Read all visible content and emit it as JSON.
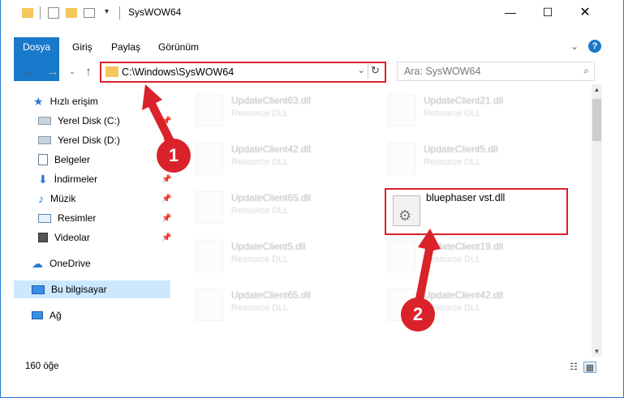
{
  "window": {
    "title": "SysWOW64",
    "controls": {
      "minimize_icon": "minimize-icon",
      "maximize_icon": "maximize-icon",
      "close_icon": "close-icon"
    }
  },
  "ribbon": {
    "tabs": [
      {
        "label": "Dosya"
      },
      {
        "label": "Giriş"
      },
      {
        "label": "Paylaş"
      },
      {
        "label": "Görünüm"
      }
    ]
  },
  "navigation": {
    "address_path": "C:\\Windows\\SysWOW64",
    "search_placeholder": "Ara: SysWOW64"
  },
  "sidebar": {
    "items": [
      {
        "label": "Hızlı erişim",
        "icon": "star-icon"
      },
      {
        "label": "Yerel Disk (C:)",
        "icon": "drive-icon"
      },
      {
        "label": "Yerel Disk (D:)",
        "icon": "drive-icon"
      },
      {
        "label": "Belgeler",
        "icon": "documents-icon"
      },
      {
        "label": "İndirmeler",
        "icon": "download-icon"
      },
      {
        "label": "Müzik",
        "icon": "music-icon"
      },
      {
        "label": "Resimler",
        "icon": "pictures-icon"
      },
      {
        "label": "Videolar",
        "icon": "videos-icon"
      },
      {
        "label": "OneDrive",
        "icon": "cloud-icon"
      },
      {
        "label": "Bu bilgisayar",
        "icon": "computer-icon"
      },
      {
        "label": "Ağ",
        "icon": "network-icon"
      }
    ]
  },
  "files": [
    {
      "name": "UpdateClient63.dll",
      "type": "Resource DLL"
    },
    {
      "name": "UpdateClient21.dll",
      "type": "Resource DLL"
    },
    {
      "name": "UpdateClient42.dll",
      "type": "Resource DLL"
    },
    {
      "name": "UpdateClient5.dll",
      "type": "Resource DLL"
    },
    {
      "name": "UpdateClient65.dll",
      "type": "Resource DLL"
    },
    {
      "name": "UpdateClient5.dll",
      "type": "Resource DLL"
    },
    {
      "name": "UpdateClient19.dll",
      "type": "Resource DLL"
    },
    {
      "name": "UpdateClient65.dll",
      "type": "Resource DLL"
    },
    {
      "name": "UpdateClient42.dll",
      "type": "Resource DLL"
    }
  ],
  "highlighted_file": {
    "name": "bluephaser vst.dll"
  },
  "status": {
    "item_count": "160 öğe"
  },
  "callouts": {
    "step1": "1",
    "step2": "2",
    "color": "#d9222a"
  },
  "colors": {
    "accent": "#1979ca",
    "selection": "#cce8ff"
  }
}
